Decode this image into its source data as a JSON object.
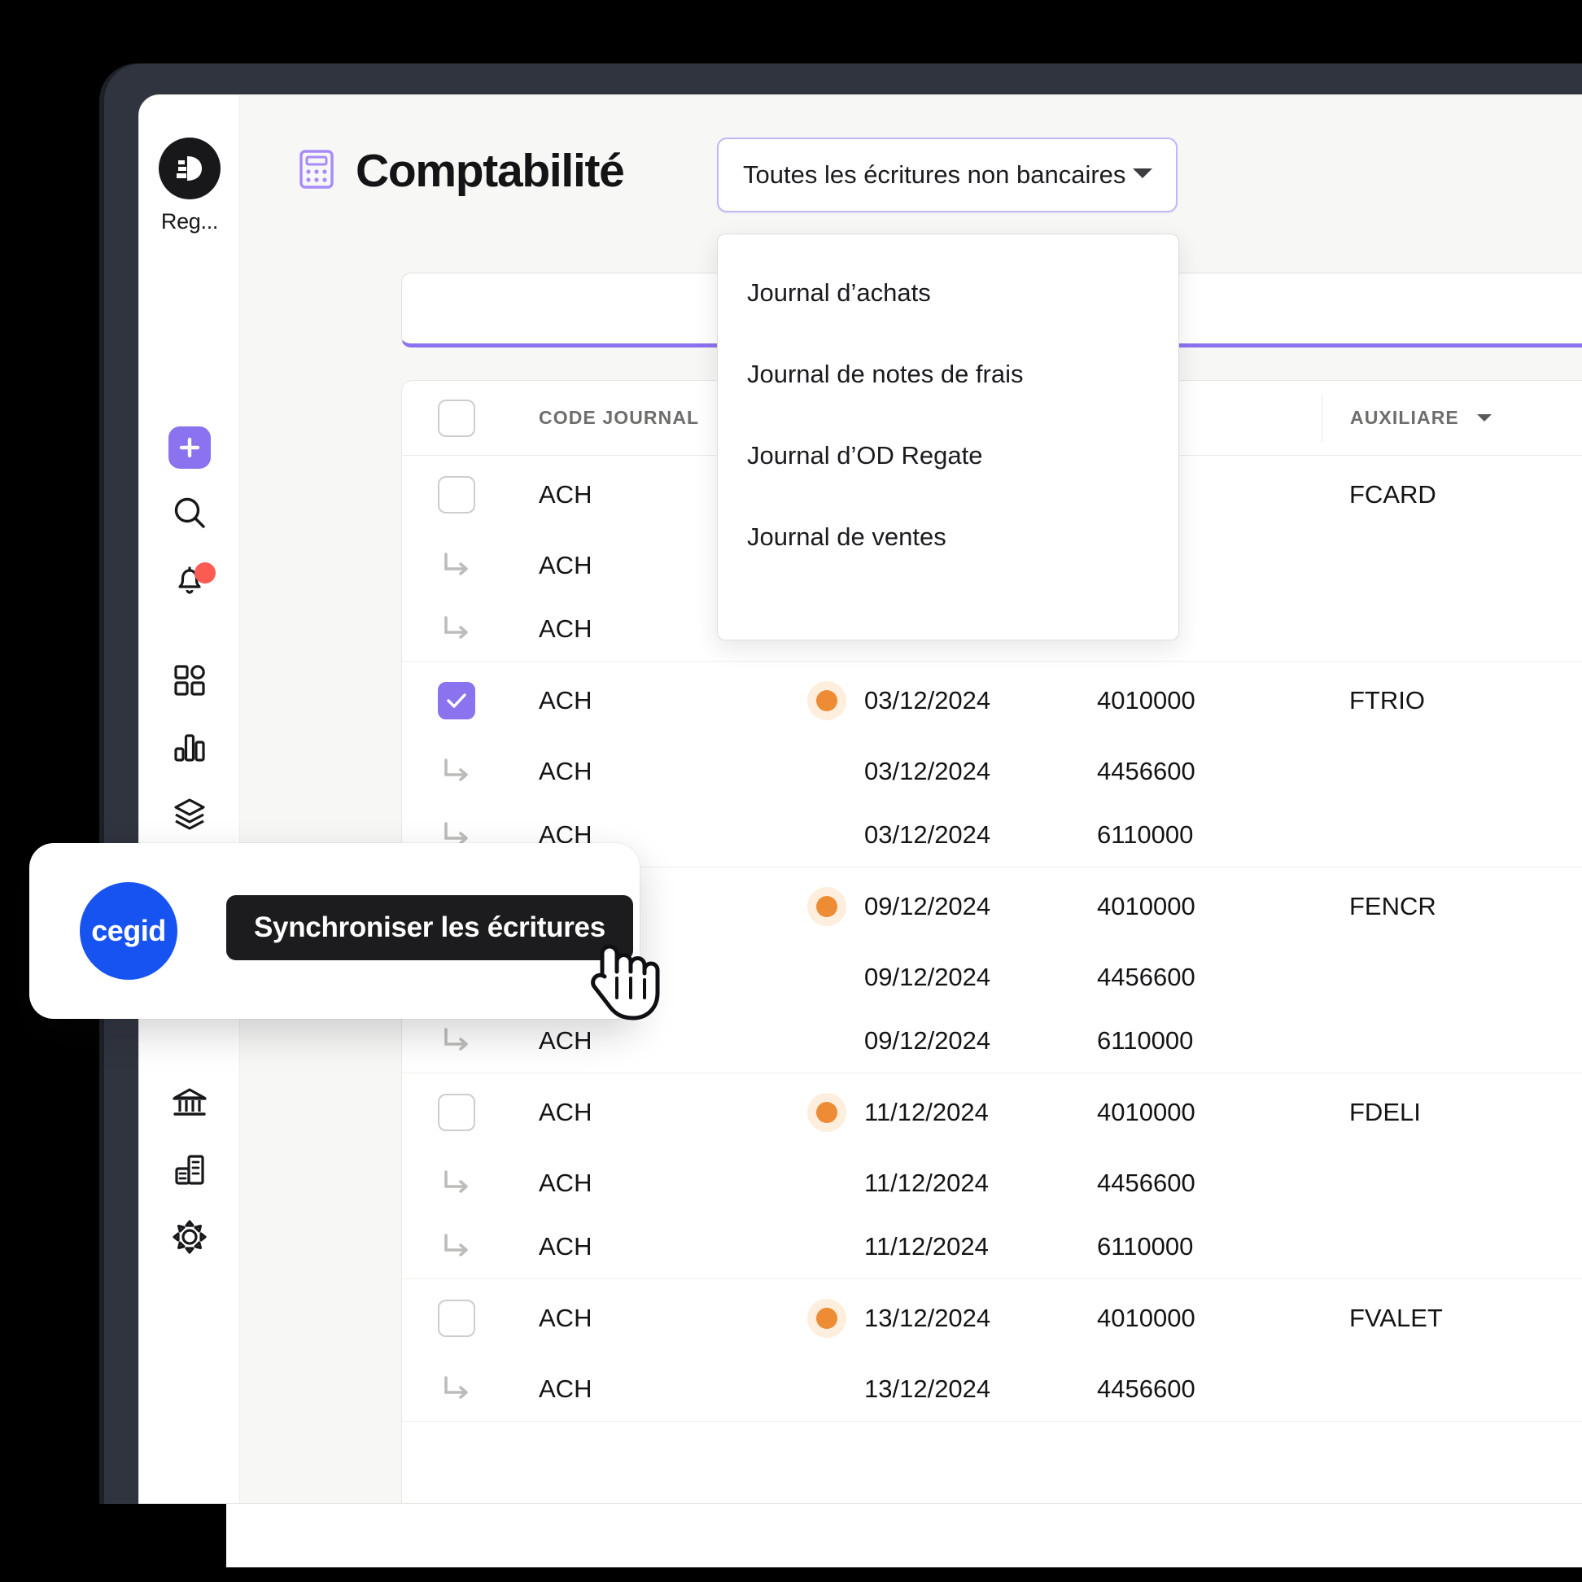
{
  "app": {
    "brand_name": "Reg...",
    "accent_purple": "#8b72ef",
    "accent_purple_light": "#c4b5fd",
    "status_orange": "#ee8c36",
    "cegid_blue": "#1753f0"
  },
  "sidebar": {
    "items": [
      {
        "name": "add",
        "icon": "plus-icon"
      },
      {
        "name": "search",
        "icon": "search-icon"
      },
      {
        "name": "notifications",
        "icon": "bell-icon",
        "badge": true
      },
      {
        "name": "dashboard",
        "icon": "grid-icon"
      },
      {
        "name": "analytics",
        "icon": "bar-chart-icon"
      },
      {
        "name": "layers",
        "icon": "layers-icon"
      },
      {
        "name": "import",
        "icon": "download-tray-icon"
      },
      {
        "name": "bank",
        "icon": "bank-icon"
      },
      {
        "name": "company",
        "icon": "building-icon"
      },
      {
        "name": "settings",
        "icon": "gear-icon"
      }
    ]
  },
  "header": {
    "title": "Comptabilité",
    "title_icon": "calculator-icon"
  },
  "journal_select": {
    "value": "Toutes les écritures non bancaires",
    "caret_icon": "chevron-down-icon",
    "options": [
      "Journal d’achats",
      "Journal de notes de frais",
      "Journal d’OD Regate",
      "Journal de ventes"
    ]
  },
  "filter_bar": {
    "value": "",
    "placeholder": ""
  },
  "table": {
    "columns": [
      {
        "key": "select",
        "label": ""
      },
      {
        "key": "code",
        "label": "CODE JOURNAL",
        "sortable": true
      },
      {
        "key": "date",
        "label": "",
        "sortable": true
      },
      {
        "key": "acct",
        "label": "",
        "sortable": true
      },
      {
        "key": "aux",
        "label": "AUXILIARE",
        "sortable": true
      }
    ],
    "groups": [
      {
        "selected": false,
        "status": false,
        "aux": "FCARD",
        "rows": [
          {
            "code": "ACH",
            "date": "",
            "acct": "",
            "lead": true
          },
          {
            "code": "ACH",
            "date": "",
            "acct": ""
          },
          {
            "code": "ACH",
            "date": "",
            "acct": ""
          }
        ]
      },
      {
        "selected": true,
        "status": true,
        "aux": "FTRIO",
        "rows": [
          {
            "code": "ACH",
            "date": "03/12/2024",
            "acct": "4010000",
            "lead": true
          },
          {
            "code": "ACH",
            "date": "03/12/2024",
            "acct": "4456600"
          },
          {
            "code": "ACH",
            "date": "03/12/2024",
            "acct": "6110000"
          }
        ]
      },
      {
        "selected": false,
        "status": true,
        "aux": "FENCR",
        "rows": [
          {
            "code": "ACH",
            "date": "09/12/2024",
            "acct": "4010000",
            "lead": true
          },
          {
            "code": "ACH",
            "date": "09/12/2024",
            "acct": "4456600"
          },
          {
            "code": "ACH",
            "date": "09/12/2024",
            "acct": "6110000"
          }
        ]
      },
      {
        "selected": false,
        "status": true,
        "aux": "FDELI",
        "rows": [
          {
            "code": "ACH",
            "date": "11/12/2024",
            "acct": "4010000",
            "lead": true
          },
          {
            "code": "ACH",
            "date": "11/12/2024",
            "acct": "4456600"
          },
          {
            "code": "ACH",
            "date": "11/12/2024",
            "acct": "6110000"
          }
        ]
      },
      {
        "selected": false,
        "status": true,
        "aux": "FVALET",
        "rows": [
          {
            "code": "ACH",
            "date": "13/12/2024",
            "acct": "4010000",
            "lead": true
          },
          {
            "code": "ACH",
            "date": "13/12/2024",
            "acct": "4456600"
          }
        ]
      }
    ]
  },
  "sync_card": {
    "logo_text": "cegid",
    "tooltip": "Synchroniser les écritures",
    "cursor_icon": "hand-pointer-icon"
  }
}
